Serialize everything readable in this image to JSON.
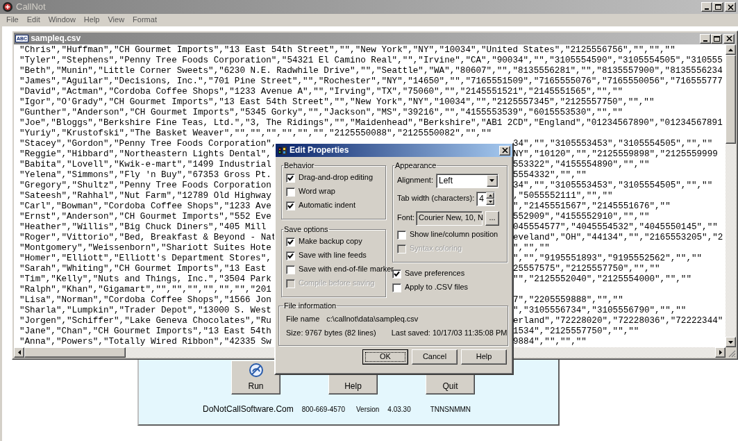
{
  "app_window": {
    "title": "CallNot"
  },
  "menu": [
    "File",
    "Edit",
    "Window",
    "Help",
    "View",
    "Format"
  ],
  "editor": {
    "title": "sampleq.csv",
    "icon_label": "ABC",
    "lines": [
      {
        "left": "\"Chris\",\"Huffman\",\"CH Gourmet Imports\",\"13 East 54th Street\",\"\",\"New York\",\"NY\",\"10034\",\"United States\",\"2125556756\",\"\",\"\",\"\""
      },
      {
        "left": "\"Tyler\",\"Stephens\",\"Penny Tree Foods Corporation\",\"54321 El Camino Real\",\"\",\"Irvine\",\"CA\",\"90034\",\"\",\"3105554590\",\"3105554505\",\"310555"
      },
      {
        "left": "\"Beth\",\"Munin\",\"Little Corner Sweets\",\"6230 N.E. Radwhile Drive\",\"\",\"Seattle\",\"WA\",\"80607\",\"\",\"8135556281\",\"\",\"8135557900\",\"8135556234"
      },
      {
        "left": "\"James\",\"Aguilar\",\"Decisions, Inc.\",\"701 Pine Street\",\"\",\"Rochester\",\"NY\",\"14650\",\"\",\"7165551509\",\"7165555076\",\"7165550056\",\"716555777"
      },
      {
        "left": "\"David\",\"Actman\",\"Cordoba Coffee Shops\",\"1233 Avenue A\",\"\",\"Irving\",\"TX\",\"75060\",\"\",\"2145551521\",\"2145551565\",\"\",\"\""
      },
      {
        "left": "\"Igor\",\"O'Grady\",\"CH Gourmet Imports\",\"13 East 54th Street\",\"\",\"New York\",\"NY\",\"10034\",\"\",\"2125557345\",\"2125557750\",\"\",\"\""
      },
      {
        "left": "\"Gunther\",\"Anderson\",\"CH Gourmet Imports\",\"5345 Gorky\",\"\",\"Jackson\",\"MS\",\"39216\",\"\",\"4155553539\",\"6015553530\",\"\",\"\""
      },
      {
        "left": "\"Joe\",\"Bloggs\",\"Berkshire Fine Teas, Ltd.\",\"3, The Ridings\",\"\",\"Maidenhead\",\"Berkshire\",\"AB1 2CD\",\"England\",\"01234567890\",\"01234567891"
      },
      {
        "left": "\"Yuriy\",\"Krustofski\",\"The Basket Weaver\",\"\",\"\",\"\",\"\",\"\",\"\",\"2125550088\",\"2125550082\",\"\",\"\""
      },
      {
        "left": "\"Stacey\",\"Gordon\",\"Penny Tree Foods Corporation\",",
        "right": "34\",\"\",\"3105553453\",\"3105554505\",\"\",\"\""
      },
      {
        "left": "\"Reggie\",\"Hibbard\",\"Northeastern Lights Dental\",",
        "right": "NY\",\"10120\",\"\",\"2125559898\",\"2125559999"
      },
      {
        "left": "\"Babita\",\"Lovell\",\"Kwik-e-mart\",\"1499 Industrial",
        "right": "553322\",\"4155554890\",\"\",\"\""
      },
      {
        "left": "\"Yelena\",\"Simmons\",\"Fly 'n Buy\",\"67353 Gross Pt.",
        "right": "5554332\",\"\",\"\""
      },
      {
        "left": "\"Gregory\",\"Shultz\",\"Penny Tree Foods Corporation",
        "right": "34\",\"\",\"3105553453\",\"3105554505\",\"\",\"\""
      },
      {
        "left": "\"Sateesh\",\"Rahhal\",\"Nut Farm\",\"12789 Old Highway",
        "right": ",\"5055552111\",\"\",\"\""
      },
      {
        "left": "\"Carl\",\"Bowman\",\"Cordoba Coffee Shops\",\"1233 Ave",
        "right": "\",\"2145551567\",\"2145551676\",\"\""
      },
      {
        "left": "\"Ernst\",\"Anderson\",\"CH Gourmet Imports\",\"552 Eve",
        "right": "552909\",\"4155552910\",\"\",\"\""
      },
      {
        "left": "\"Heather\",\"Willis\",\"Big Chuck Diners\",\"405 Mill",
        "right": "045554577\",\"4045554532\",\"4045550145\",\"\""
      },
      {
        "left": "\"Roger\",\"Vittorio\",\"Bed, Breakfast & Beyond - Nat",
        "right": "eveland\",\"OH\",\"44134\",\"\",\"2165553205\",\"2"
      },
      {
        "left": "\"Montgomery\",\"Weissenborn\",\"Shariott Suites Hote",
        "right": "\",\"\",\"\""
      },
      {
        "left": "\"Homer\",\"Elliott\",\"Elliott's Department Stores\",",
        "right": "\",\"\",\"9195551893\",\"9195552562\",\"\",\"\""
      },
      {
        "left": "\"Sarah\",\"Whiting\",\"CH Gourmet Imports\",\"13 East",
        "right": "25557575\",\"2125557750\",\"\",\"\""
      },
      {
        "left": "\"Tim\",\"Kelly\",\"Nuts and Things, Inc.\",\"3504 Park",
        "right": "\"\",\"2125552040\",\"2125554000\",\"\",\"\""
      },
      {
        "left": "\"Ralph\",\"Khan\",\"Gigamart\",\"\",\"\",\"\",\"\",\"\",\"\",\"201"
      },
      {
        "left": "\"Lisa\",\"Norman\",\"Cordoba Coffee Shops\",\"1566 Jon",
        "right": "7\",\"2205559888\",\"\",\"\""
      },
      {
        "left": "\"Sharla\",\"Lumpkin\",\"Trader Depot\",\"13000 S. West",
        "right": "\",\"3105556734\",\"3105556790\",\"\",\"\""
      },
      {
        "left": "\"Jorgen\",\"Schiffer\",\"Lake Geneva Chocolates\",\"Ru",
        "right": "erland\",\"72228020\",\"72228036\",\"72222344\""
      },
      {
        "left": "\"Jane\",\"Chan\",\"CH Gourmet Imports\",\"13 East 54th",
        "right": "1534\",\"2125557750\",\"\",\"\""
      },
      {
        "left": "\"Anna\",\"Powers\",\"Totally Wired Ribbon\",\"42335 Sw",
        "right": "9884\",\"\",\"\",\"\""
      }
    ]
  },
  "launcher": {
    "buttons": [
      {
        "label": "Run",
        "kind": "run"
      },
      {
        "label": "Help",
        "kind": "plain"
      },
      {
        "label": "Quit",
        "kind": "plain"
      }
    ],
    "footer": {
      "link": "DoNotCallSoftware.Com",
      "phone": "800-669-4570",
      "version_label": "Version",
      "version": "4.03.30",
      "code": "TNNSNMMN"
    }
  },
  "dialog": {
    "title": "Edit Properties",
    "behavior": {
      "title": "Behavior",
      "options": [
        {
          "label": "Drag-and-drop editing",
          "checked": true,
          "disabled": false
        },
        {
          "label": "Word wrap",
          "checked": false,
          "disabled": false
        },
        {
          "label": "Automatic indent",
          "checked": true,
          "disabled": false
        }
      ]
    },
    "save_options": {
      "title": "Save options",
      "options": [
        {
          "label": "Make backup copy",
          "checked": true,
          "disabled": false
        },
        {
          "label": "Save with line feeds",
          "checked": true,
          "disabled": false
        },
        {
          "label": "Save with end-of-file marker",
          "checked": false,
          "disabled": false
        },
        {
          "label": "Compile before saving",
          "checked": false,
          "disabled": true
        }
      ]
    },
    "appearance": {
      "title": "Appearance",
      "alignment": {
        "label": "Alignment:",
        "value": "Left"
      },
      "tab_width": {
        "label": "Tab width (characters):",
        "value": "4"
      },
      "font": {
        "label": "Font:",
        "value": "Courier New, 10, N",
        "button": "..."
      },
      "options": [
        {
          "label": "Show line/column position",
          "checked": false,
          "disabled": false
        },
        {
          "label": "Syntax coloring",
          "checked": false,
          "disabled": true
        }
      ]
    },
    "preferences": [
      {
        "label": "Save preferences",
        "checked": true,
        "disabled": false
      },
      {
        "label": "Apply to .CSV files",
        "checked": false,
        "disabled": false
      }
    ],
    "file_info": {
      "title": "File information",
      "file_name_label": "File name",
      "file_name": "c:\\callnot\\data\\sampleq.csv",
      "size": "Size: 9767 bytes (82 lines)",
      "last_saved": "Last saved: 10/17/03 11:35:08 PM"
    },
    "buttons": [
      {
        "label": "OK",
        "focused": true
      },
      {
        "label": "Cancel",
        "focused": false
      },
      {
        "label": "Help",
        "focused": false
      }
    ]
  }
}
